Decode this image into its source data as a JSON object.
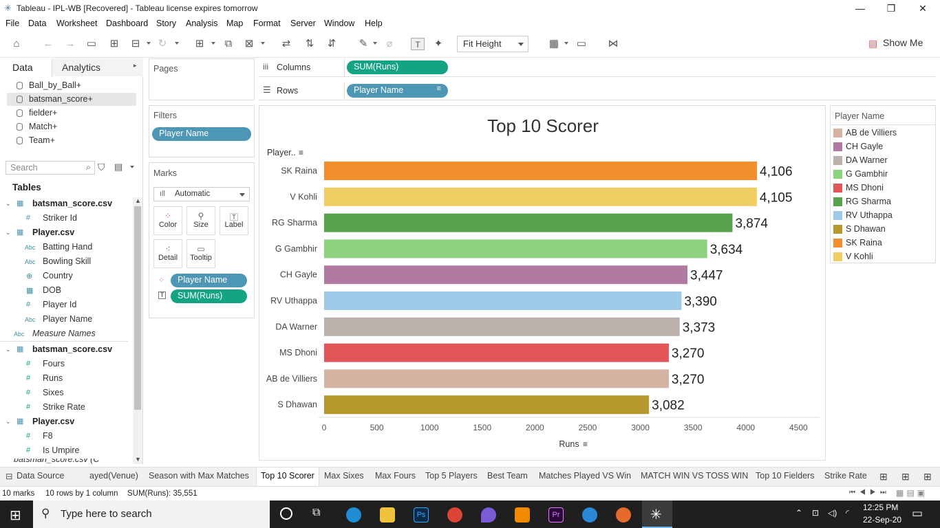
{
  "window": {
    "title": "Tableau - IPL-WB [Recovered] - Tableau license expires tomorrow"
  },
  "menu": [
    "File",
    "Data",
    "Worksheet",
    "Dashboard",
    "Story",
    "Analysis",
    "Map",
    "Format",
    "Server",
    "Window",
    "Help"
  ],
  "toolbar": {
    "fit": "Fit Height",
    "show_me": "Show Me"
  },
  "data_pane": {
    "tabs": {
      "data": "Data",
      "analytics": "Analytics"
    },
    "sources": [
      "Ball_by_Ball+",
      "batsman_score+",
      "fielder+",
      "Match+",
      "Team+"
    ],
    "search_placeholder": "Search",
    "tables_label": "Tables",
    "tables": [
      {
        "name": "batsman_score.csv",
        "fields": [
          {
            "glyph": "#",
            "name": "Striker Id"
          }
        ]
      },
      {
        "name": "Player.csv",
        "fields": [
          {
            "glyph": "Abc",
            "name": "Batting Hand"
          },
          {
            "glyph": "Abc",
            "name": "Bowling Skill"
          },
          {
            "glyph": "⊕",
            "name": "Country"
          },
          {
            "glyph": "▦",
            "name": "DOB"
          },
          {
            "glyph": "#",
            "name": "Player Id"
          },
          {
            "glyph": "Abc",
            "name": "Player Name"
          }
        ]
      },
      {
        "name": "Measure Names"
      },
      {
        "name": "batsman_score.csv",
        "fields": [
          {
            "glyph": "#",
            "name": "Fours"
          },
          {
            "glyph": "#",
            "name": "Runs"
          },
          {
            "glyph": "#",
            "name": "Sixes"
          },
          {
            "glyph": "#",
            "name": "Strike Rate"
          }
        ]
      },
      {
        "name": "Player.csv",
        "fields": [
          {
            "glyph": "#",
            "name": "F8"
          },
          {
            "glyph": "#",
            "name": "Is Umpire"
          }
        ]
      },
      {
        "name": "batsman_score.csv (C"
      }
    ]
  },
  "cards": {
    "pages": "Pages",
    "filters": "Filters",
    "filter_pill": "Player Name",
    "marks": "Marks",
    "mark_type": "Automatic",
    "mark_buttons": [
      "Color",
      "Size",
      "Label",
      "Detail",
      "Tooltip"
    ],
    "mark_pills": [
      "Player Name",
      "SUM(Runs)"
    ]
  },
  "shelves": {
    "columns_label": "Columns",
    "columns_pill": "SUM(Runs)",
    "rows_label": "Rows",
    "rows_pill": "Player Name"
  },
  "legend": {
    "title": "Player Name",
    "items": [
      {
        "name": "AB de Villiers",
        "color": "#d4b3a3"
      },
      {
        "name": "CH Gayle",
        "color": "#b07aa1"
      },
      {
        "name": "DA Warner",
        "color": "#bab0ac"
      },
      {
        "name": "G Gambhir",
        "color": "#8cd17d"
      },
      {
        "name": "MS Dhoni",
        "color": "#e15759"
      },
      {
        "name": "RG Sharma",
        "color": "#59a14f"
      },
      {
        "name": "RV Uthappa",
        "color": "#a0cbe8"
      },
      {
        "name": "S Dhawan",
        "color": "#b6992d"
      },
      {
        "name": "SK Raina",
        "color": "#f28e2b"
      },
      {
        "name": "V Kohli",
        "color": "#f1ce63"
      }
    ]
  },
  "chart_data": {
    "type": "bar",
    "orientation": "horizontal",
    "title": "Top 10 Scorer",
    "ylabel": "Player..",
    "xlabel": "Runs",
    "xlim": [
      0,
      4700
    ],
    "xticks": [
      0,
      500,
      1000,
      1500,
      2000,
      2500,
      3000,
      3500,
      4000,
      4500
    ],
    "bars": [
      {
        "name": "SK Raina",
        "value": 4106,
        "label": "4,106",
        "color": "#f28e2b"
      },
      {
        "name": "V Kohli",
        "value": 4105,
        "label": "4,105",
        "color": "#f1ce63"
      },
      {
        "name": "RG Sharma",
        "value": 3874,
        "label": "3,874",
        "color": "#59a14f"
      },
      {
        "name": "G Gambhir",
        "value": 3634,
        "label": "3,634",
        "color": "#8cd17d"
      },
      {
        "name": "CH Gayle",
        "value": 3447,
        "label": "3,447",
        "color": "#b07aa1"
      },
      {
        "name": "RV Uthappa",
        "value": 3390,
        "label": "3,390",
        "color": "#a0cbe8"
      },
      {
        "name": "DA Warner",
        "value": 3373,
        "label": "3,373",
        "color": "#bab0ac"
      },
      {
        "name": "MS Dhoni",
        "value": 3270,
        "label": "3,270",
        "color": "#e15759"
      },
      {
        "name": "AB de Villiers",
        "value": 3270,
        "label": "3,270",
        "color": "#d4b3a3"
      },
      {
        "name": "S Dhawan",
        "value": 3082,
        "label": "3,082",
        "color": "#b6992d"
      }
    ]
  },
  "sheet_tabs": [
    "Data Source",
    "ayed(Venue)",
    "Season with Max Matches",
    "Top 10 Scorer",
    "Max  Sixes",
    "Max Fours",
    "Top 5 Players",
    "Best Team",
    "Matches Played VS Win",
    "MATCH WIN VS TOSS WIN",
    "Top 10 Fielders",
    "Strike Rate"
  ],
  "active_tab": "Top 10 Scorer",
  "status": {
    "marks": "10 marks",
    "rows": "10 rows by 1 column",
    "sum": "SUM(Runs): 35,551"
  },
  "taskbar": {
    "search_placeholder": "Type here to search",
    "time": "12:25 PM",
    "date": "22-Sep-20"
  }
}
